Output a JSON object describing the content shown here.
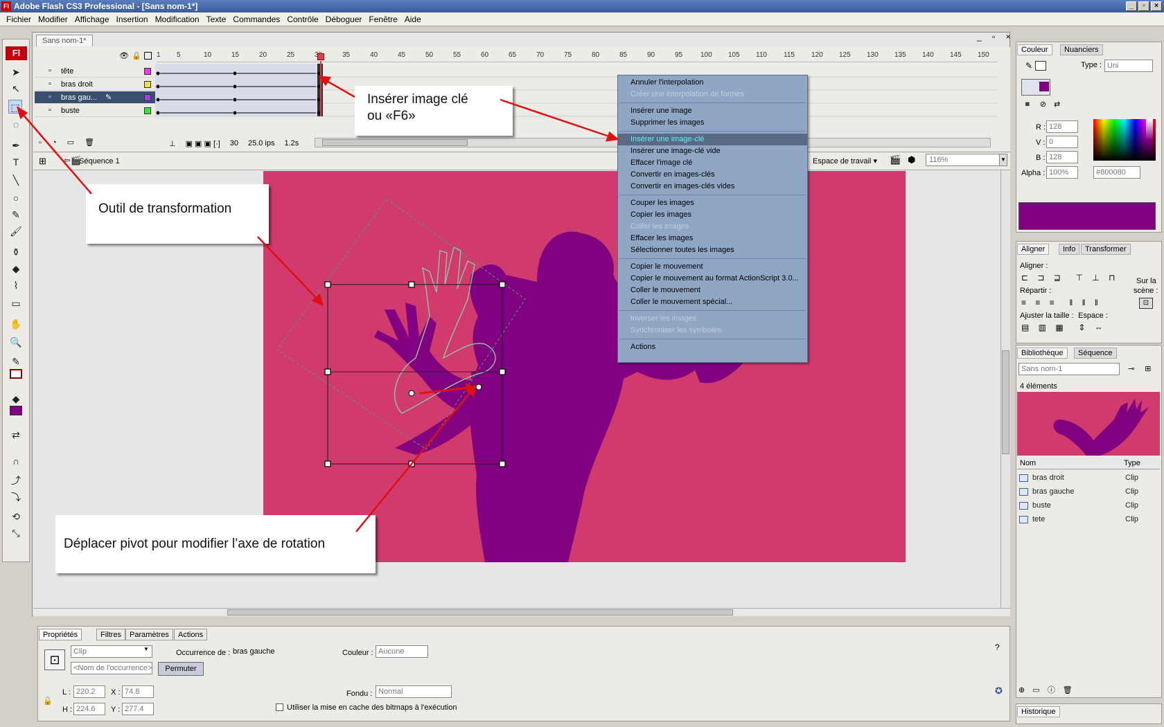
{
  "app": {
    "title": "Adobe Flash CS3 Professional - [Sans nom-1*]",
    "logo": "Fl",
    "win_min": "_",
    "win_max": "▫",
    "win_close": "×"
  },
  "menu": [
    "Fichier",
    "Modifier",
    "Affichage",
    "Insertion",
    "Modification",
    "Texte",
    "Commandes",
    "Contrôle",
    "Déboguer",
    "Fenêtre",
    "Aide"
  ],
  "document": {
    "tab": "Sans nom-1*",
    "scene": "Séquence 1",
    "workspace": "Espace de travail",
    "zoom": "116%"
  },
  "timeline": {
    "ruler": [
      "1",
      "5",
      "10",
      "15",
      "20",
      "25",
      "30",
      "35",
      "40",
      "45",
      "50",
      "55",
      "60",
      "65",
      "70",
      "75",
      "80",
      "85",
      "90",
      "95",
      "100",
      "105",
      "110",
      "115",
      "120",
      "125",
      "130",
      "135",
      "140",
      "145",
      "150"
    ],
    "layers": [
      {
        "name": "tête",
        "color": "#e040e0"
      },
      {
        "name": "bras droit",
        "color": "#f0e040"
      },
      {
        "name": "bras gau...",
        "color": "#a040e0"
      },
      {
        "name": "buste",
        "color": "#40e040"
      }
    ],
    "current_frame": "30",
    "fps": "25.0 ips",
    "time": "1.2s"
  },
  "context_menu": [
    {
      "label": "Annuler l'interpolation",
      "state": "normal"
    },
    {
      "label": "Créer une interpolation de formes",
      "state": "disabled"
    },
    {
      "sep": true
    },
    {
      "label": "Insérer une image",
      "state": "normal"
    },
    {
      "label": "Supprimer les images",
      "state": "normal"
    },
    {
      "sep": true
    },
    {
      "label": "Insérer une image-clé",
      "state": "highlight"
    },
    {
      "label": "Insérer une image-clé vide",
      "state": "normal"
    },
    {
      "label": "Effacer l'image clé",
      "state": "normal"
    },
    {
      "label": "Convertir en images-clés",
      "state": "normal"
    },
    {
      "label": "Convertir en images-clés vides",
      "state": "normal"
    },
    {
      "sep": true
    },
    {
      "label": "Couper les images",
      "state": "normal"
    },
    {
      "label": "Copier les images",
      "state": "normal"
    },
    {
      "label": "Coller les images",
      "state": "disabled"
    },
    {
      "label": "Effacer les images",
      "state": "normal"
    },
    {
      "label": "Sélectionner toutes les images",
      "state": "normal"
    },
    {
      "sep": true
    },
    {
      "label": "Copier le mouvement",
      "state": "normal"
    },
    {
      "label": "Copier le mouvement au format ActionScript 3.0...",
      "state": "normal"
    },
    {
      "label": "Coller le mouvement",
      "state": "normal"
    },
    {
      "label": "Coller le mouvement spécial...",
      "state": "normal"
    },
    {
      "sep": true
    },
    {
      "label": "Inverser les images",
      "state": "disabled"
    },
    {
      "label": "Synchroniser les symboles",
      "state": "disabled"
    },
    {
      "sep": true
    },
    {
      "label": "Actions",
      "state": "normal"
    }
  ],
  "callouts": {
    "keyframe_line1": "Insérer image clé",
    "keyframe_line2": "ou «F6»",
    "transform": "Outil de transformation",
    "pivot": "Déplacer pivot pour modifier l’axe de rotation"
  },
  "properties": {
    "tabs": [
      "Propriétés",
      "Filtres",
      "Paramètres",
      "Actions"
    ],
    "type": "Clip",
    "instance_label": "Occurrence de :",
    "instance_value": "bras gauche",
    "instance_name_placeholder": "<Nom de l'occurrence>",
    "swap_button": "Permuter",
    "color_label": "Couleur :",
    "color_value": "Aucune",
    "blend_label": "Fondu :",
    "blend_value": "Normal",
    "cache_label": "Utiliser la mise en cache des bitmaps à l'exécution",
    "w_label": "L :",
    "w_value": "220.2",
    "h_label": "H :",
    "h_value": "224.6",
    "x_label": "X :",
    "x_value": "74.8",
    "y_label": "Y :",
    "y_value": "277.4"
  },
  "color_panel": {
    "tabs": [
      "Couleur",
      "Nuanciers"
    ],
    "type_label": "Type :",
    "type_value": "Uni",
    "r_label": "R :",
    "r_value": "128",
    "g_label": "V :",
    "g_value": "0",
    "b_label": "B :",
    "b_value": "128",
    "alpha_label": "Alpha :",
    "alpha_value": "100%",
    "hex": "#800080",
    "swatch": "#800080"
  },
  "align_panel": {
    "tabs": [
      "Aligner",
      "Info",
      "Transformer"
    ],
    "align_label": "Aligner :",
    "distribute_label": "Répartir :",
    "match_label": "Ajuster la taille :",
    "space_label": "Espace :",
    "stage_label_1": "Sur la",
    "stage_label_2": "scène :"
  },
  "library": {
    "tabs": [
      "Bibliothèque",
      "Séquence"
    ],
    "document": "Sans nom-1",
    "count": "4 éléments",
    "col_name": "Nom",
    "col_type": "Type",
    "items": [
      {
        "name": "bras droit",
        "type": "Clip"
      },
      {
        "name": "bras gauche",
        "type": "Clip"
      },
      {
        "name": "buste",
        "type": "Clip"
      },
      {
        "name": "tete",
        "type": "Clip"
      }
    ]
  },
  "history": {
    "tab": "Historique"
  },
  "colors": {
    "stage": "#d13a6c",
    "figure": "#800080",
    "menu_bg": "#8fa6c4",
    "highlight_text": "#5ef0ff"
  }
}
